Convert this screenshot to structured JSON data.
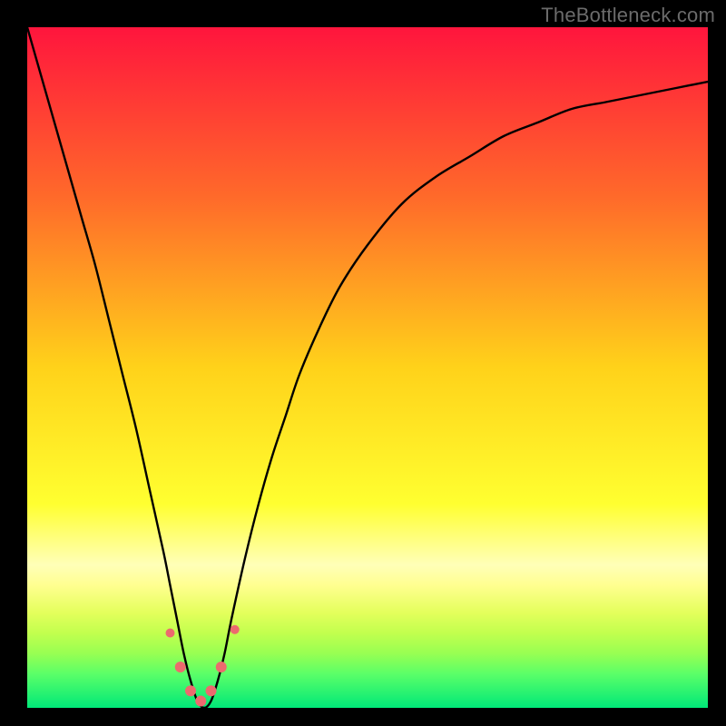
{
  "watermark": "TheBottleneck.com",
  "chart_data": {
    "type": "line",
    "title": "",
    "xlabel": "",
    "ylabel": "",
    "xlim": [
      0,
      100
    ],
    "ylim": [
      0,
      100
    ],
    "grid": false,
    "series": [
      {
        "name": "main-curve",
        "color": "#000000",
        "x": [
          0,
          2,
          4,
          6,
          8,
          10,
          12,
          14,
          16,
          18,
          20,
          21,
          22,
          23,
          24,
          25,
          26,
          27,
          28,
          29,
          30,
          32,
          34,
          36,
          38,
          40,
          43,
          46,
          50,
          55,
          60,
          65,
          70,
          75,
          80,
          85,
          90,
          95,
          100
        ],
        "y": [
          100,
          93,
          86,
          79,
          72,
          65,
          57,
          49,
          41,
          32,
          23,
          18,
          13,
          8,
          4,
          1,
          0,
          1,
          4,
          8,
          13,
          22,
          30,
          37,
          43,
          49,
          56,
          62,
          68,
          74,
          78,
          81,
          84,
          86,
          88,
          89,
          90,
          91,
          92
        ]
      }
    ],
    "markers": {
      "name": "dip-markers",
      "color": "#ec6a6e",
      "radius_main": 6,
      "radius_end": 5,
      "points": [
        {
          "x": 21.0,
          "y": 11.0
        },
        {
          "x": 22.5,
          "y": 6.0
        },
        {
          "x": 24.0,
          "y": 2.5
        },
        {
          "x": 25.5,
          "y": 1.0
        },
        {
          "x": 27.0,
          "y": 2.5
        },
        {
          "x": 28.5,
          "y": 6.0
        },
        {
          "x": 30.5,
          "y": 11.5
        }
      ]
    }
  }
}
